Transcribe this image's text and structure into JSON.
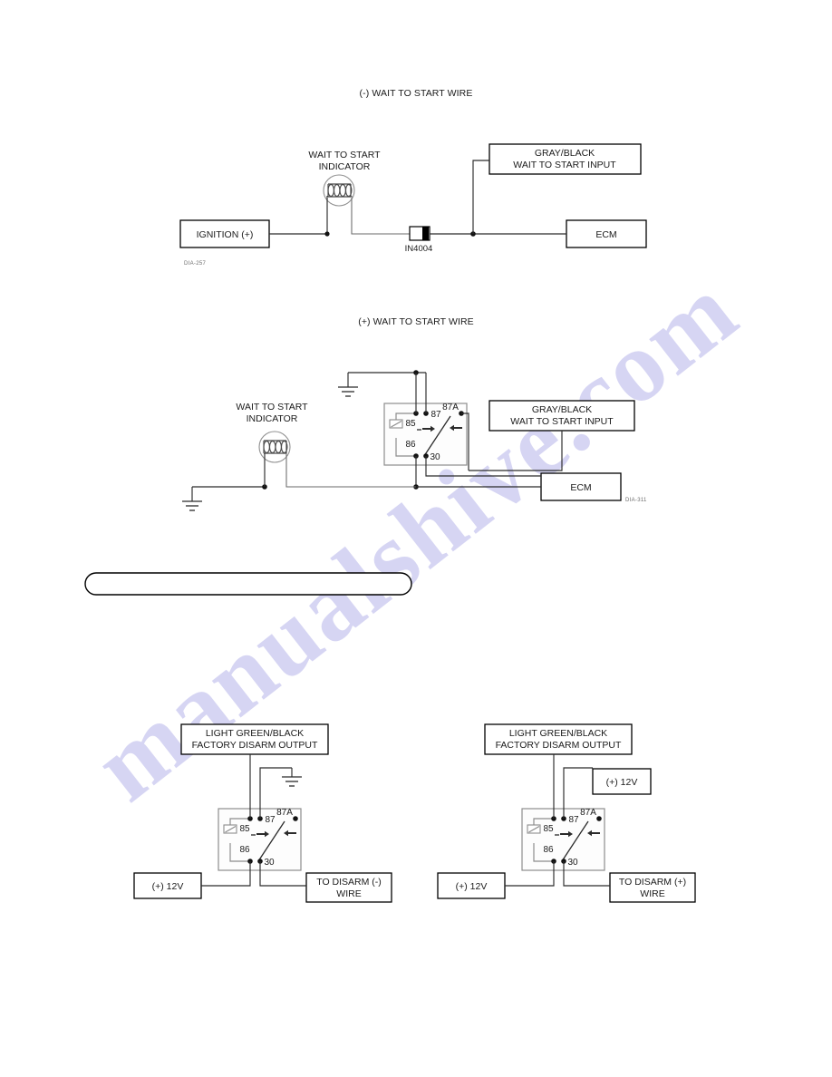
{
  "page": {
    "watermark": "manualshive.com",
    "background_color": "#ffffff",
    "ink_color": "#1a1a1a"
  },
  "diagrams": [
    {
      "id": "negative-wait-to-start",
      "title": "(-) WAIT TO START WIRE",
      "reference": "DIA-257",
      "boxes": {
        "ignition": "IGNITION (+)",
        "ecm": "ECM",
        "input_line1": "GRAY/BLACK",
        "input_line2": "WAIT TO START INPUT"
      },
      "labels": {
        "indicator_line1": "WAIT TO START",
        "indicator_line2": "INDICATOR",
        "diode": "IN4004"
      }
    },
    {
      "id": "positive-wait-to-start",
      "title": "(+) WAIT TO START WIRE",
      "reference": "DIA-311",
      "boxes": {
        "ecm": "ECM",
        "input_line1": "GRAY/BLACK",
        "input_line2": "WAIT TO START INPUT"
      },
      "labels": {
        "indicator_line1": "WAIT TO START",
        "indicator_line2": "INDICATOR"
      },
      "relay_terminals": {
        "t85": "85",
        "t86": "86",
        "t87": "87",
        "t87a": "87A",
        "t30": "30"
      }
    },
    {
      "id": "factory-disarm-negative",
      "boxes": {
        "output_line1": "LIGHT GREEN/BLACK",
        "output_line2": "FACTORY DISARM OUTPUT",
        "power": "(+) 12V",
        "disarm_line1": "TO DISARM (-)",
        "disarm_line2": "WIRE"
      },
      "relay_terminals": {
        "t85": "85",
        "t86": "86",
        "t87": "87",
        "t87a": "87A",
        "t30": "30"
      }
    },
    {
      "id": "factory-disarm-positive",
      "boxes": {
        "output_line1": "LIGHT GREEN/BLACK",
        "output_line2": "FACTORY DISARM OUTPUT",
        "power_top": "(+) 12V",
        "power_bottom": "(+) 12V",
        "disarm_line1": "TO DISARM (+)",
        "disarm_line2": "WIRE"
      },
      "relay_terminals": {
        "t85": "85",
        "t86": "86",
        "t87": "87",
        "t87a": "87A",
        "t30": "30"
      }
    }
  ],
  "banner": {
    "text": ""
  }
}
